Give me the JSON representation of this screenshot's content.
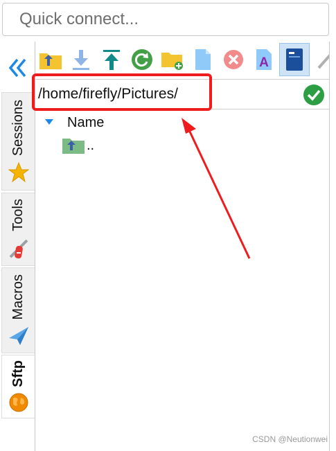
{
  "quick_connect": {
    "placeholder": "Quick connect..."
  },
  "sidebar": {
    "tabs": [
      {
        "label": "Sessions",
        "icon": "star-icon"
      },
      {
        "label": "Tools",
        "icon": "tools-icon"
      },
      {
        "label": "Macros",
        "icon": "paper-plane-icon"
      },
      {
        "label": "Sftp",
        "icon": "globe-icon",
        "active": true
      }
    ]
  },
  "toolbar": {
    "buttons": [
      "parent-folder-icon",
      "download-icon",
      "upload-icon",
      "refresh-icon",
      "new-folder-icon",
      "new-file-icon",
      "delete-icon",
      "rename-icon",
      "follow-terminal-icon",
      "wand-icon"
    ]
  },
  "path": {
    "value": "/home/firefly/Pictures/"
  },
  "file_list": {
    "columns": [
      "Name"
    ],
    "rows": [
      {
        "name": "..",
        "icon": "parent-folder-icon"
      }
    ]
  },
  "watermark": "CSDN @Neutionwei",
  "colors": {
    "annotation_red": "#ee1c1c",
    "accent_blue": "#1e88e5",
    "ok_green": "#2e9e45",
    "folder_yellow": "#f4c430"
  }
}
